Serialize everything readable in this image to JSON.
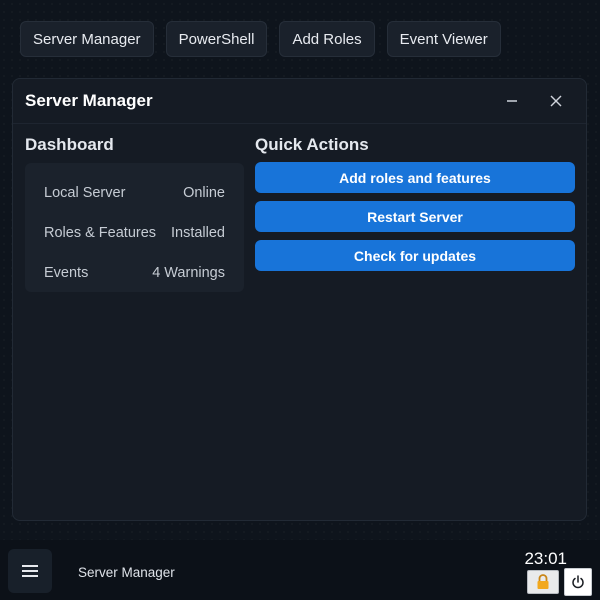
{
  "launcher": {
    "items": [
      {
        "label": "Server Manager"
      },
      {
        "label": "PowerShell"
      },
      {
        "label": "Add Roles"
      },
      {
        "label": "Event Viewer"
      }
    ]
  },
  "window": {
    "title": "Server Manager",
    "controls": {
      "minimize_icon": "minimize-icon",
      "close_icon": "close-icon"
    }
  },
  "dashboard": {
    "heading": "Dashboard",
    "rows": [
      {
        "label": "Local Server",
        "value": "Online"
      },
      {
        "label": "Roles & Features",
        "value": "Installed"
      },
      {
        "label": "Events",
        "value": "4 Warnings"
      }
    ]
  },
  "quick_actions": {
    "heading": "Quick Actions",
    "buttons": [
      {
        "label": "Add roles and features"
      },
      {
        "label": "Restart Server"
      },
      {
        "label": "Check for updates"
      }
    ]
  },
  "taskbar": {
    "start_icon": "menu-icon",
    "active_app": "Server Manager",
    "clock": "23:01",
    "tray": {
      "lock_icon": "lock-icon",
      "power_icon": "power-icon"
    }
  },
  "colors": {
    "accent": "#1874d9",
    "background": "#0e141c",
    "window": "#151b24",
    "card": "#1b222c"
  }
}
